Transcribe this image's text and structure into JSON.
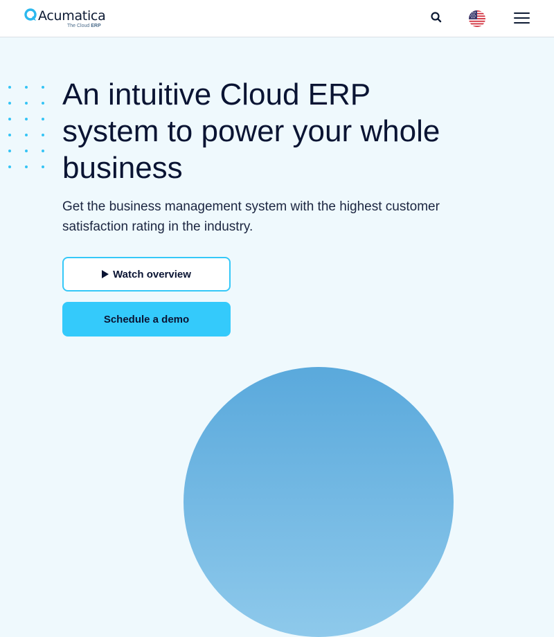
{
  "header": {
    "logo": {
      "name": "Acumatica",
      "tagline_prefix": "The Cloud",
      "tagline_emphasis": "ERP"
    },
    "icons": {
      "search": "search-icon",
      "language": "us-flag-icon",
      "menu": "hamburger-menu-icon"
    }
  },
  "hero": {
    "title": "An intuitive Cloud ERP system to power your whole business",
    "subtitle": "Get the business management system with the highest customer satisfaction rating in the industry.",
    "buttons": {
      "watch_overview": "Watch overview",
      "schedule_demo": "Schedule a demo"
    }
  },
  "colors": {
    "accent": "#34cafb",
    "page_background": "#eff9fd",
    "text_dark": "#0a1433",
    "circle": "#6cb6e2"
  }
}
